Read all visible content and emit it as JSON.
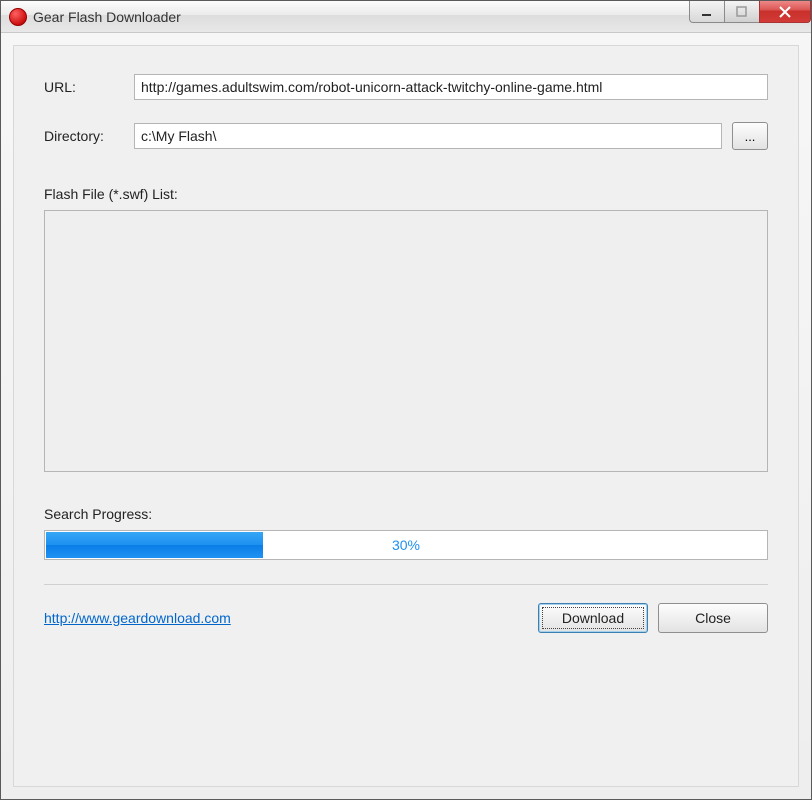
{
  "window": {
    "title": "Gear Flash Downloader"
  },
  "form": {
    "url_label": "URL:",
    "url_value": "http://games.adultswim.com/robot-unicorn-attack-twitchy-online-game.html",
    "directory_label": "Directory:",
    "directory_value": "c:\\My Flash\\",
    "browse_label": "...",
    "list_label": "Flash File (*.swf) List:",
    "progress_label": "Search Progress:",
    "progress_percent": 30,
    "progress_text": "30%"
  },
  "footer": {
    "link_text": "http://www.geardownload.com",
    "download_label": "Download",
    "close_label": "Close"
  }
}
